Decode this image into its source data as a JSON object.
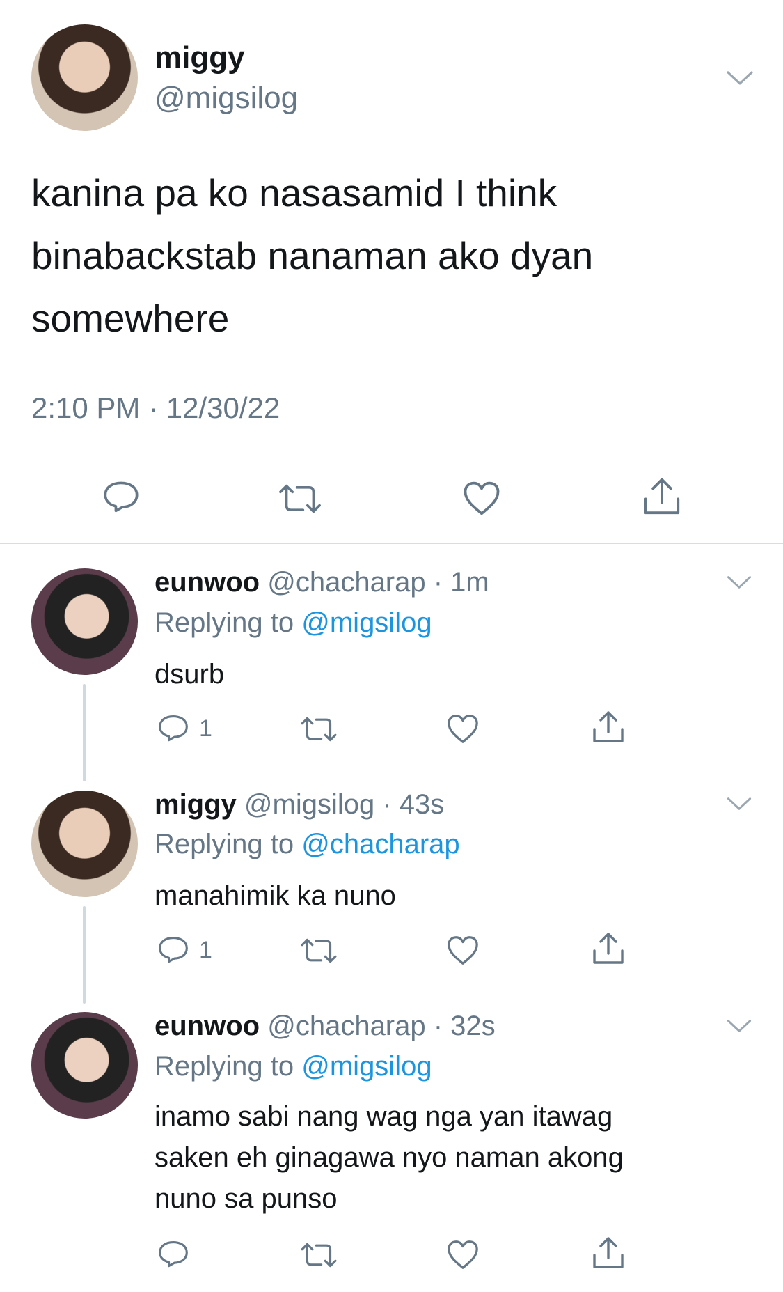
{
  "tweet": {
    "display_name": "miggy",
    "handle": "@migsilog",
    "text_lines": [
      "kanina pa ko nasasamid I think",
      "binabackstab nanaman ako dyan",
      "somewhere"
    ],
    "timestamp": "2:10 PM · 12/30/22"
  },
  "replies": [
    {
      "display_name": "eunwoo",
      "meta": "@chacharap · 1m",
      "replying_prefix": "Replying to",
      "replying_to": "@migsilog",
      "text_lines": [
        "dsurb"
      ],
      "reply_count": "1"
    },
    {
      "display_name": "miggy",
      "meta": "@migsilog · 43s",
      "replying_prefix": "Replying to",
      "replying_to": "@chacharap",
      "text_lines": [
        "manahimik ka nuno"
      ],
      "reply_count": "1"
    },
    {
      "display_name": "eunwoo",
      "meta": "@chacharap · 32s",
      "replying_prefix": "Replying to",
      "replying_to": "@migsilog",
      "text_lines": [
        "inamo sabi nang wag nga yan itawag",
        "saken eh ginagawa nyo naman akong",
        "nuno sa punso"
      ],
      "reply_count": ""
    }
  ],
  "icons": [
    "reply-icon",
    "retweet-icon",
    "like-icon",
    "share-icon",
    "chevron-down-icon"
  ],
  "colors": {
    "link": "#1b95e0",
    "secondary": "#657786",
    "divider": "#d8dde1"
  }
}
